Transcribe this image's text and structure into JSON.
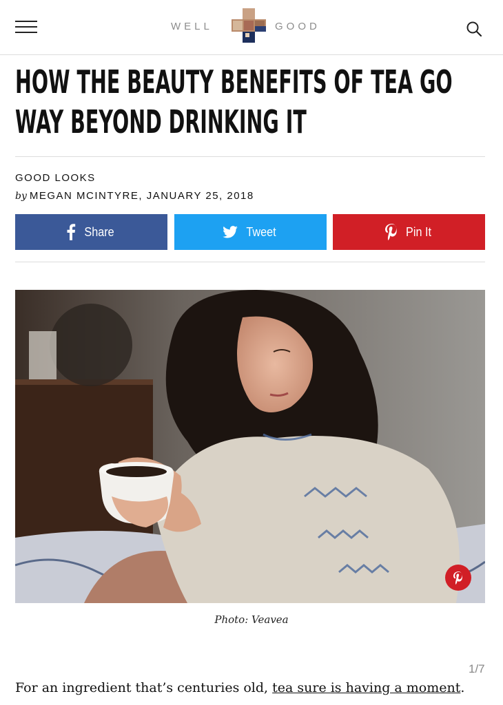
{
  "header": {
    "logo_left": "WELL",
    "logo_right": "GOOD",
    "menu_icon": "hamburger-menu-icon",
    "search_icon": "search-icon"
  },
  "article": {
    "title": "HOW THE BEAUTY BENEFITS OF TEA GO WAY BEYOND DRINKING IT",
    "category": "GOOD LOOKS",
    "by": "by",
    "author_date": "MEGAN MCINTYRE, JANUARY 25, 2018"
  },
  "share": {
    "facebook_label": "Share",
    "twitter_label": "Tweet",
    "pinterest_label": "Pin It",
    "colors": {
      "facebook": "#3b5998",
      "twitter": "#1da1f2",
      "pinterest": "#d11f26"
    }
  },
  "photo": {
    "caption": "Photo: Veavea"
  },
  "slideshow": {
    "counter": "1/7"
  },
  "body": {
    "intro_text": "For an ingredient that’s centuries old, ",
    "intro_link": "tea sure is having a moment",
    "intro_end": "."
  }
}
